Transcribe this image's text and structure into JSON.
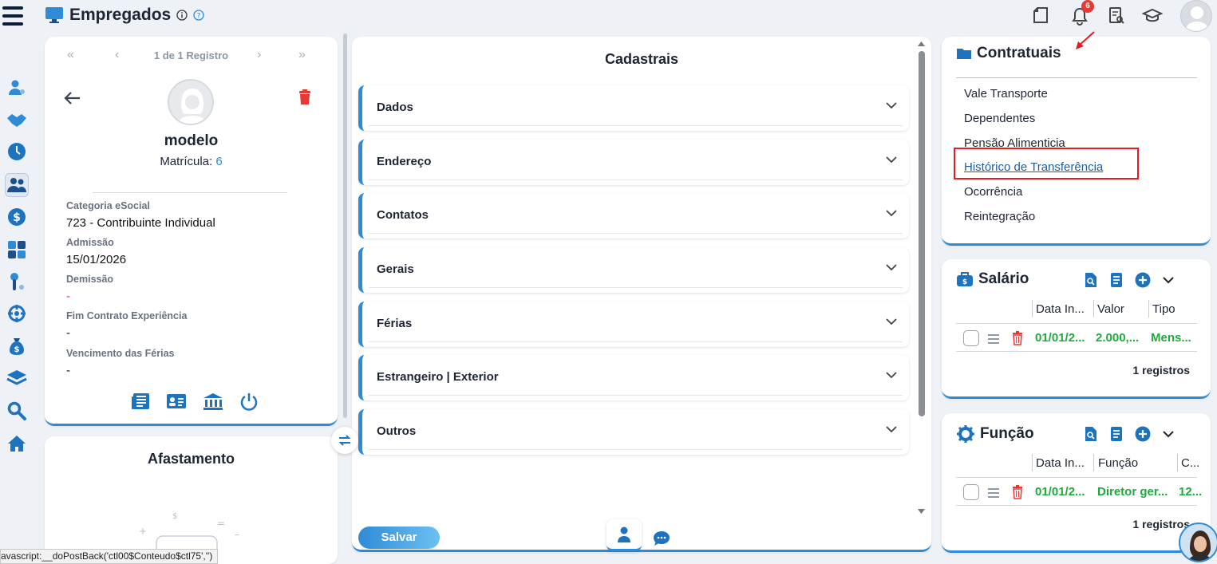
{
  "header": {
    "title": "Empregados",
    "notifications_count": "6"
  },
  "profile": {
    "pager_text": "1 de 1 Registro",
    "name": "modelo",
    "matricula_label": "Matrícula:",
    "matricula_value": "6",
    "fields": [
      {
        "label": "Categoria eSocial",
        "value": "723 - Contribuinte Individual"
      },
      {
        "label": "Admissão",
        "value": "15/01/2026"
      },
      {
        "label": "Demissão",
        "value": "-"
      },
      {
        "label": "Fim Contrato Experiência",
        "value": "-"
      },
      {
        "label": "Vencimento das Férias",
        "value": "-"
      }
    ]
  },
  "afastamento": {
    "title": "Afastamento"
  },
  "cadastrais": {
    "title": "Cadastrais",
    "sections": [
      "Dados",
      "Endereço",
      "Contatos",
      "Gerais",
      "Férias",
      "Estrangeiro | Exterior",
      "Outros"
    ],
    "save_label": "Salvar"
  },
  "contratuais": {
    "title": "Contratuais",
    "links": [
      "Vale Transporte",
      "Dependentes",
      "Pensão Alimenticia",
      "Histórico de Transferência",
      "Ocorrência",
      "Reintegração"
    ]
  },
  "salario": {
    "title": "Salário",
    "columns": [
      "Data In...",
      "Valor",
      "Tipo"
    ],
    "row": [
      "01/01/2...",
      "2.000,...",
      "Mens..."
    ],
    "count": "1 registros"
  },
  "funcao": {
    "title": "Função",
    "columns": [
      "Data In...",
      "Função",
      "C..."
    ],
    "row": [
      "01/01/2...",
      "Diretor ger...",
      "12..."
    ],
    "count": "1 registros"
  },
  "statusbar": {
    "text": "avascript:__doPostBack('ctl00$Conteudo$ctl75','')"
  },
  "colors": {
    "accent": "#2f8bd6",
    "success": "#1eaa3c",
    "danger": "#e53935",
    "highlight": "#e31b23"
  }
}
